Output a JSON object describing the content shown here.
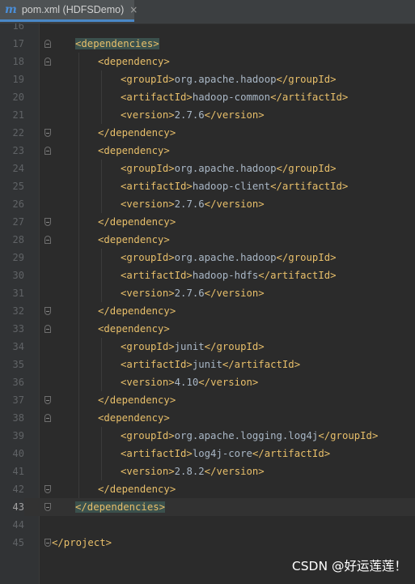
{
  "tab": {
    "icon": "m",
    "title": "pom.xml (HDFSDemo)",
    "close": "×"
  },
  "lines": [
    {
      "n": "16",
      "parts": []
    },
    {
      "n": "17",
      "parts": [
        {
          "t": "<dependencies>",
          "c": "tag hl"
        }
      ]
    },
    {
      "n": "18",
      "parts": [
        {
          "t": "<dependency>",
          "c": "tag"
        }
      ]
    },
    {
      "n": "19",
      "parts": [
        {
          "t": "<groupId>",
          "c": "tag"
        },
        {
          "t": "org.apache.hadoop",
          "c": "val"
        },
        {
          "t": "</groupId>",
          "c": "tag"
        }
      ]
    },
    {
      "n": "20",
      "parts": [
        {
          "t": "<artifactId>",
          "c": "tag"
        },
        {
          "t": "hadoop-common",
          "c": "val"
        },
        {
          "t": "</artifactId>",
          "c": "tag"
        }
      ]
    },
    {
      "n": "21",
      "parts": [
        {
          "t": "<version>",
          "c": "tag"
        },
        {
          "t": "2.7.6",
          "c": "val"
        },
        {
          "t": "</version>",
          "c": "tag"
        }
      ]
    },
    {
      "n": "22",
      "parts": [
        {
          "t": "</dependency>",
          "c": "tag"
        }
      ]
    },
    {
      "n": "23",
      "parts": [
        {
          "t": "<dependency>",
          "c": "tag"
        }
      ]
    },
    {
      "n": "24",
      "parts": [
        {
          "t": "<groupId>",
          "c": "tag"
        },
        {
          "t": "org.apache.hadoop",
          "c": "val"
        },
        {
          "t": "</groupId>",
          "c": "tag"
        }
      ]
    },
    {
      "n": "25",
      "parts": [
        {
          "t": "<artifactId>",
          "c": "tag"
        },
        {
          "t": "hadoop-client",
          "c": "val"
        },
        {
          "t": "</artifactId>",
          "c": "tag"
        }
      ]
    },
    {
      "n": "26",
      "parts": [
        {
          "t": "<version>",
          "c": "tag"
        },
        {
          "t": "2.7.6",
          "c": "val"
        },
        {
          "t": "</version>",
          "c": "tag"
        }
      ]
    },
    {
      "n": "27",
      "parts": [
        {
          "t": "</dependency>",
          "c": "tag"
        }
      ]
    },
    {
      "n": "28",
      "parts": [
        {
          "t": "<dependency>",
          "c": "tag"
        }
      ]
    },
    {
      "n": "29",
      "parts": [
        {
          "t": "<groupId>",
          "c": "tag"
        },
        {
          "t": "org.apache.hadoop",
          "c": "val"
        },
        {
          "t": "</groupId>",
          "c": "tag"
        }
      ]
    },
    {
      "n": "30",
      "parts": [
        {
          "t": "<artifactId>",
          "c": "tag"
        },
        {
          "t": "hadoop-hdfs",
          "c": "val"
        },
        {
          "t": "</artifactId>",
          "c": "tag"
        }
      ]
    },
    {
      "n": "31",
      "parts": [
        {
          "t": "<version>",
          "c": "tag"
        },
        {
          "t": "2.7.6",
          "c": "val"
        },
        {
          "t": "</version>",
          "c": "tag"
        }
      ]
    },
    {
      "n": "32",
      "parts": [
        {
          "t": "</dependency>",
          "c": "tag"
        }
      ]
    },
    {
      "n": "33",
      "parts": [
        {
          "t": "<dependency>",
          "c": "tag"
        }
      ]
    },
    {
      "n": "34",
      "parts": [
        {
          "t": "<groupId>",
          "c": "tag"
        },
        {
          "t": "junit",
          "c": "val"
        },
        {
          "t": "</groupId>",
          "c": "tag"
        }
      ]
    },
    {
      "n": "35",
      "parts": [
        {
          "t": "<artifactId>",
          "c": "tag"
        },
        {
          "t": "junit",
          "c": "val"
        },
        {
          "t": "</artifactId>",
          "c": "tag"
        }
      ]
    },
    {
      "n": "36",
      "parts": [
        {
          "t": "<version>",
          "c": "tag"
        },
        {
          "t": "4.10",
          "c": "val"
        },
        {
          "t": "</version>",
          "c": "tag"
        }
      ]
    },
    {
      "n": "37",
      "parts": [
        {
          "t": "</dependency>",
          "c": "tag"
        }
      ]
    },
    {
      "n": "38",
      "parts": [
        {
          "t": "<dependency>",
          "c": "tag"
        }
      ]
    },
    {
      "n": "39",
      "parts": [
        {
          "t": "<groupId>",
          "c": "tag"
        },
        {
          "t": "org.apache.logging.log4j",
          "c": "val"
        },
        {
          "t": "</groupId>",
          "c": "tag"
        }
      ]
    },
    {
      "n": "40",
      "parts": [
        {
          "t": "<artifactId>",
          "c": "tag"
        },
        {
          "t": "log4j-core",
          "c": "val"
        },
        {
          "t": "</artifactId>",
          "c": "tag"
        }
      ]
    },
    {
      "n": "41",
      "parts": [
        {
          "t": "<version>",
          "c": "tag"
        },
        {
          "t": "2.8.2",
          "c": "val"
        },
        {
          "t": "</version>",
          "c": "tag"
        }
      ]
    },
    {
      "n": "42",
      "parts": [
        {
          "t": "</dependency>",
          "c": "tag"
        }
      ]
    },
    {
      "n": "43",
      "parts": [
        {
          "t": "</dependencies>",
          "c": "tag hl"
        }
      ],
      "current": true
    },
    {
      "n": "44",
      "parts": []
    },
    {
      "n": "45",
      "parts": [
        {
          "t": "</project>",
          "c": "tag"
        }
      ]
    }
  ],
  "watermark": "CSDN @好运莲莲！",
  "colors": {
    "background": "#2b2b2b",
    "tag": "#e8bf6a",
    "text": "#a9b7c6",
    "line_number": "#606366",
    "match_highlight": "#3b514d"
  }
}
